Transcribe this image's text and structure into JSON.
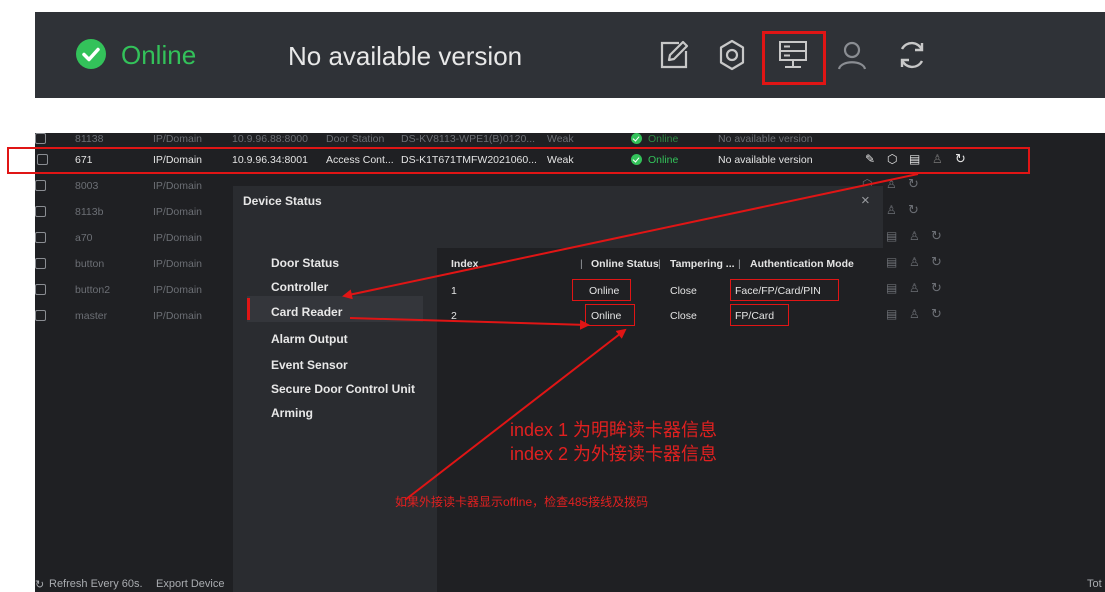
{
  "banner": {
    "status": "Online",
    "version": "No available version",
    "icons": [
      "edit-icon",
      "settings-icon",
      "device-status-icon",
      "user-icon",
      "refresh-icon"
    ]
  },
  "table": {
    "rows": [
      {
        "name": "81138",
        "type": "IP/Domain",
        "ip": "10.9.96.88:8000",
        "dev": "Door Station",
        "model": "DS-KV8113-WPE1(B)0120...",
        "sec": "Weak",
        "status": "Online",
        "ver": "No available version"
      },
      {
        "name": "671",
        "type": "IP/Domain",
        "ip": "10.9.96.34:8001",
        "dev": "Access Cont...",
        "model": "DS-K1T671TMFW2021060...",
        "sec": "Weak",
        "status": "Online",
        "ver": "No available version"
      },
      {
        "name": "8003",
        "type": "IP/Domain",
        "ip": "",
        "dev": "",
        "model": "",
        "sec": "",
        "status": "",
        "ver": ""
      },
      {
        "name": "8113b",
        "type": "IP/Domain",
        "ip": "",
        "dev": "",
        "model": "",
        "sec": "",
        "status": "",
        "ver": ""
      },
      {
        "name": "a70",
        "type": "IP/Domain",
        "ip": "",
        "dev": "",
        "model": "",
        "sec": "",
        "status": "",
        "ver": ""
      },
      {
        "name": "button",
        "type": "IP/Domain",
        "ip": "",
        "dev": "",
        "model": "",
        "sec": "",
        "status": "",
        "ver": ""
      },
      {
        "name": "button2",
        "type": "IP/Domain",
        "ip": "",
        "dev": "",
        "model": "",
        "sec": "",
        "status": "",
        "ver": ""
      },
      {
        "name": "master",
        "type": "IP/Domain",
        "ip": "",
        "dev": "",
        "model": "",
        "sec": "",
        "status": "",
        "ver": ""
      }
    ]
  },
  "bottom": {
    "refresh": "Refresh Every 60s.",
    "export": "Export Device",
    "total": "Tot"
  },
  "modal": {
    "title": "Device Status",
    "close": "×",
    "nav": [
      "Door Status",
      "Controller",
      "Card Reader",
      "Alarm Output",
      "Event Sensor",
      "Secure Door Control Unit",
      "Arming"
    ],
    "columns": [
      "Index",
      "Online Status",
      "Tampering ...",
      "Authentication Mode"
    ],
    "rows": [
      {
        "index": "1",
        "online": "Online",
        "tamper": "Close",
        "auth": "Face/FP/Card/PIN"
      },
      {
        "index": "2",
        "online": "Online",
        "tamper": "Close",
        "auth": "FP/Card"
      }
    ]
  },
  "annotations": {
    "line1": "index 1 为明眸读卡器信息",
    "line2": "index 2 为外接读卡器信息",
    "line3": "如果外接读卡器显示offine，检查485接线及拨码"
  },
  "colors": {
    "online_green": "#33c25a",
    "highlight_red": "#e01515",
    "panel_dark": "#2a2c30"
  }
}
